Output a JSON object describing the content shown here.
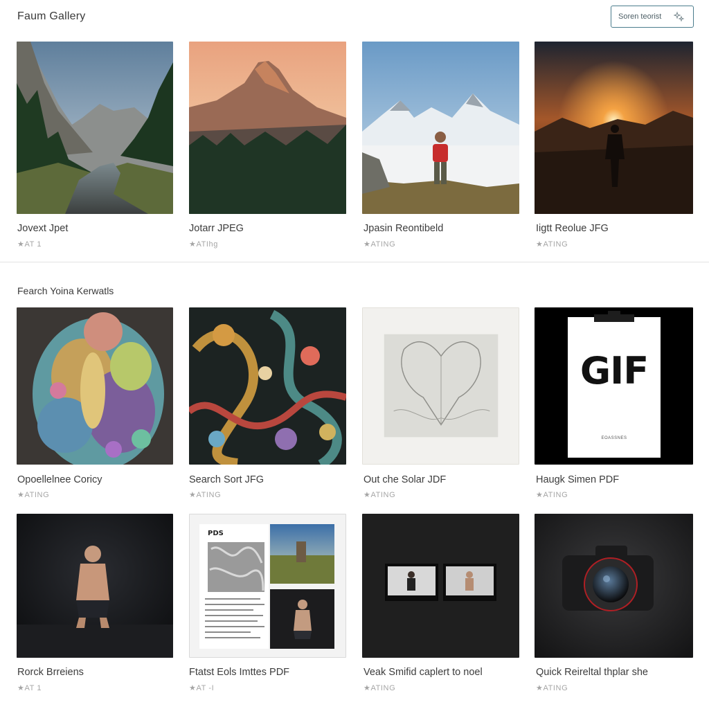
{
  "header": {
    "title": "Faum Gallery",
    "search_button_label": "Soren teorist"
  },
  "section2": {
    "title": "Fearch Yoina Kerwatls"
  },
  "items": [
    {
      "caption": "Jovext Jpet",
      "rating": "★AT 1"
    },
    {
      "caption": "Jotarr JPEG",
      "rating": "★ATIhg"
    },
    {
      "caption": "Jpasin Reontibeld",
      "rating": "★ATING"
    },
    {
      "caption": "Iigtt Reolue JFG",
      "rating": "★ATING"
    },
    {
      "caption": "Opoellelnee Coricy",
      "rating": "★ATING"
    },
    {
      "caption": "Search Sort JFG",
      "rating": "★ATING"
    },
    {
      "caption": "Out che Solar JDF",
      "rating": "★ATING"
    },
    {
      "caption": "Haugk Simen PDF",
      "rating": "★ATING"
    },
    {
      "caption": "Rorck Brreiens",
      "rating": "★AT 1"
    },
    {
      "caption": "Ftatst Eols Imttes PDF",
      "rating": "★AT -I"
    },
    {
      "caption": "Veak Smifid caplert to noel",
      "rating": "★ATING"
    },
    {
      "caption": "Quick Reireltal thplar she",
      "rating": "★ATING"
    }
  ],
  "thumb_text": {
    "gif_label": "GIF",
    "gif_sub": "EOASSNES",
    "pdf_label": "PDS"
  },
  "icons": {
    "search": "sparkle-search-icon"
  },
  "colors": {
    "accent_border": "#4a7c8c",
    "rating_gray": "#a5a5a5",
    "divider": "#e3e3e3"
  }
}
